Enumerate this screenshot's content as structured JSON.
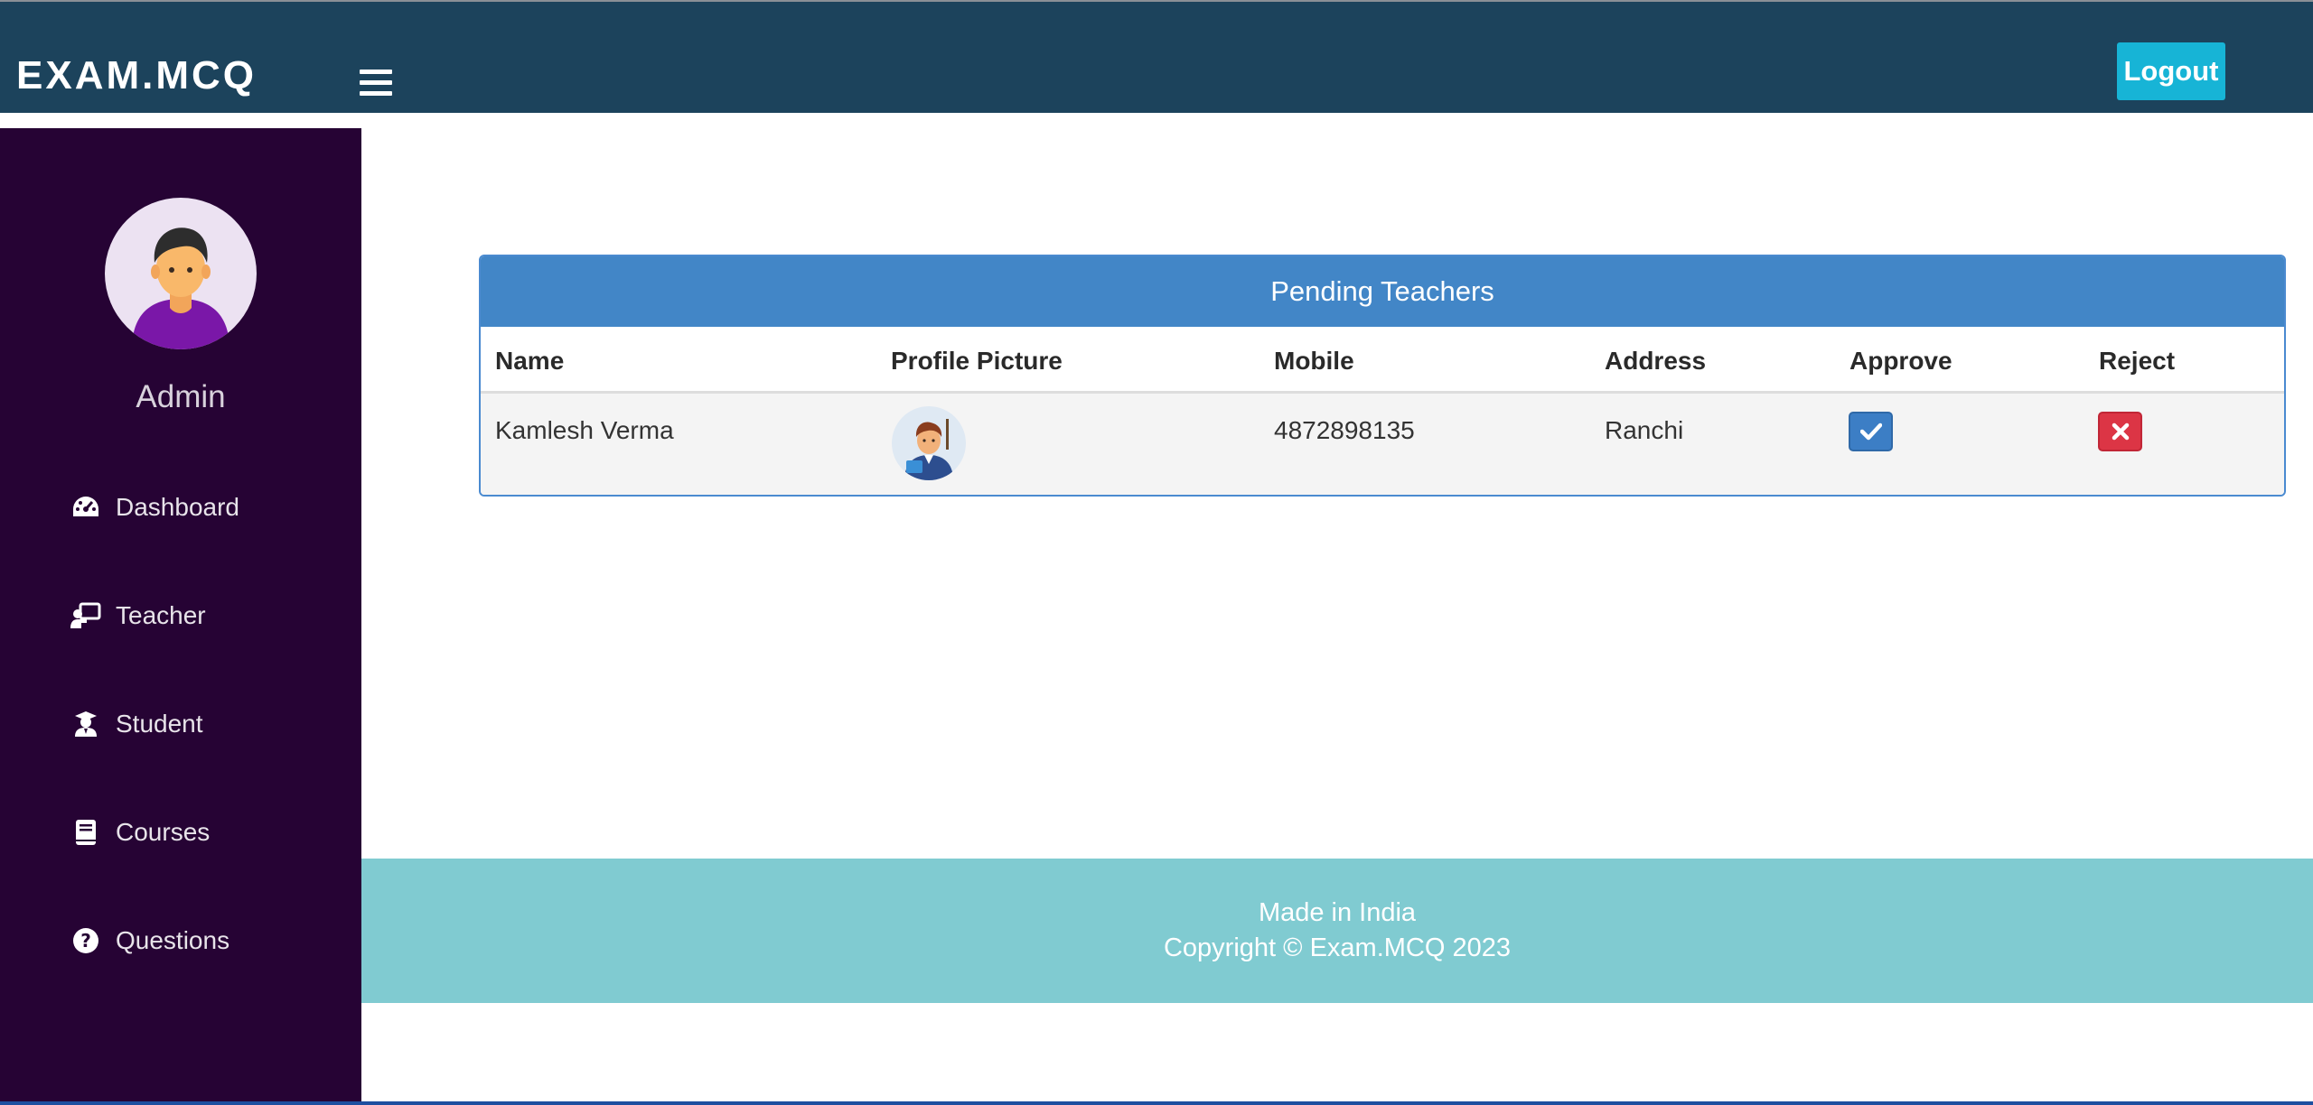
{
  "header": {
    "brand": "EXAM.MCQ",
    "logout_label": "Logout"
  },
  "sidebar": {
    "user_name": "Admin",
    "items": [
      {
        "label": "Dashboard",
        "icon": "dashboard-icon"
      },
      {
        "label": "Teacher",
        "icon": "teacher-icon"
      },
      {
        "label": "Student",
        "icon": "student-icon"
      },
      {
        "label": "Courses",
        "icon": "book-icon"
      },
      {
        "label": "Questions",
        "icon": "question-circle-icon"
      }
    ]
  },
  "main": {
    "panel_title": "Pending Teachers",
    "columns": [
      "Name",
      "Profile Picture",
      "Mobile",
      "Address",
      "Approve",
      "Reject"
    ],
    "rows": [
      {
        "name": "Kamlesh Verma",
        "mobile": "4872898135",
        "address": "Ranchi"
      }
    ]
  },
  "footer": {
    "line1": "Made in India",
    "line2": "Copyright © Exam.MCQ 2023"
  },
  "colors": {
    "topbar": "#1c435c",
    "sidebar": "#260334",
    "panel_heading": "#4286c7",
    "approve": "#3c7ec5",
    "reject": "#dc3545",
    "footer": "#80cbd1",
    "logout": "#17b4d6"
  }
}
